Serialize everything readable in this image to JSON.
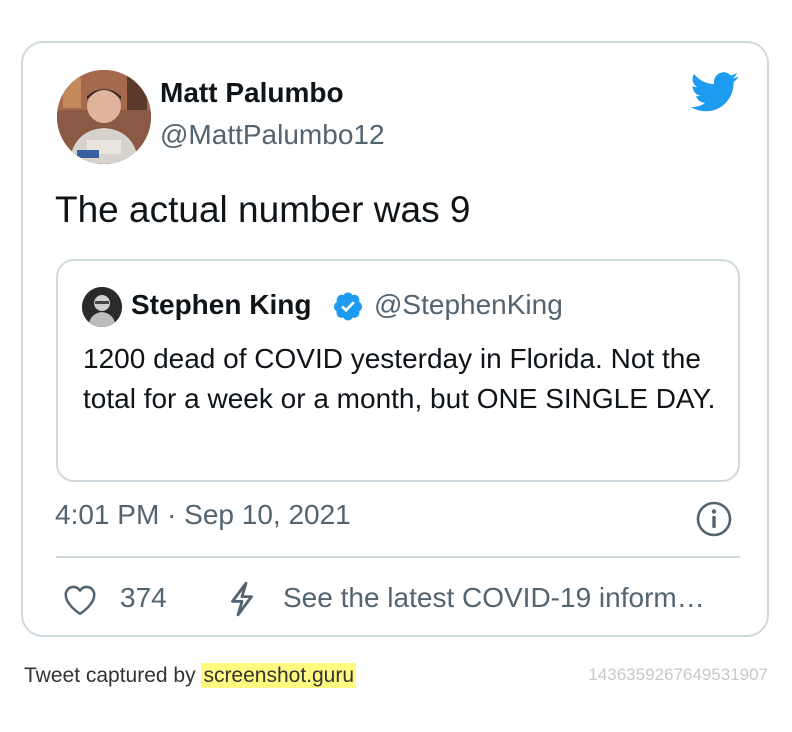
{
  "tweet": {
    "author_name": "Matt Palumbo",
    "author_handle": "@MattPalumbo12",
    "text": "The actual number was 9",
    "timestamp": "4:01 PM · Sep 10, 2021",
    "like_count": "374",
    "covid_link": "See the latest COVID-19 inform…"
  },
  "quoted": {
    "author_name": "Stephen King",
    "author_handle": "@StephenKing",
    "verified": true,
    "text": "1200 dead of COVID yesterday in Florida. Not the total for a week or a month, but ONE SINGLE DAY."
  },
  "footer": {
    "prefix": "Tweet captured by ",
    "brand": "screenshot.guru",
    "tweet_id": "1436359267649531907"
  },
  "colors": {
    "twitter_blue": "#1d9bf0",
    "secondary_text": "#536471",
    "border": "#cfd9de",
    "highlight": "#fffa80"
  },
  "icons": [
    "twitter-bird-icon",
    "verified-badge-icon",
    "info-icon",
    "heart-icon",
    "bolt-icon"
  ]
}
